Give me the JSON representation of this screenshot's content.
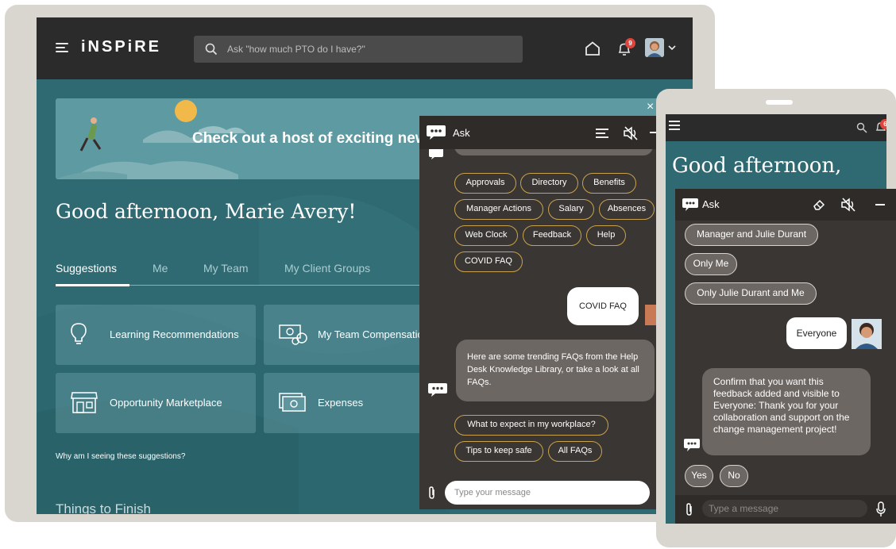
{
  "laptop": {
    "header": {
      "logo": "iNSPiRE",
      "search_placeholder": "Ask \"how much PTO do I have?\"",
      "notification_count": "9"
    },
    "banner_text": "Check out a host of exciting new",
    "greeting": "Good afternoon, Marie Avery!",
    "tabs": [
      {
        "label": "Suggestions"
      },
      {
        "label": "Me"
      },
      {
        "label": "My Team"
      },
      {
        "label": "My Client Groups"
      }
    ],
    "cards": [
      {
        "label": "Learning Recommendations",
        "icon": "lightbulb-icon"
      },
      {
        "label": "My Team Compensation",
        "icon": "money-icon"
      },
      {
        "label": "Opportunity Marketplace",
        "icon": "storefront-icon"
      },
      {
        "label": "Expenses",
        "icon": "cash-icon"
      }
    ],
    "why_link": "Why am I seeing these suggestions?",
    "things_heading": "Things to Finish",
    "close_label": "×",
    "chat": {
      "title": "Ask",
      "quick_actions": [
        "Approvals",
        "Directory",
        "Benefits",
        "Manager Actions",
        "Salary",
        "Absences",
        "Web Clock",
        "Feedback",
        "Help",
        "COVID FAQ"
      ],
      "user_message": "COVID FAQ",
      "bot_message": "Here are some trending FAQs from the Help Desk Knowledge Library, or take a look at all FAQs.",
      "faq_options": [
        "What to expect in my workplace?",
        "Tips to keep safe",
        "All FAQs"
      ],
      "input_placeholder": "Type your message"
    }
  },
  "tablet": {
    "notification_count": "6",
    "greeting": "Good afternoon,",
    "chat": {
      "title": "Ask",
      "options": [
        "Manager and Julie Durant",
        "Only Me",
        "Only Julie Durant and Me"
      ],
      "user_message": "Everyone",
      "bot_message": "Confirm that you want this feedback added and visible to Everyone: Thank you for your collaboration and support on the change management project!",
      "confirm_options": [
        "Yes",
        "No"
      ],
      "input_placeholder": "Type a message"
    }
  },
  "colors": {
    "teal_background": "#2f6a72",
    "topbar": "#2b2b2b",
    "chat_background": "#3a3633",
    "pill_border": "#c9a24b",
    "badge": "#e0443a"
  }
}
